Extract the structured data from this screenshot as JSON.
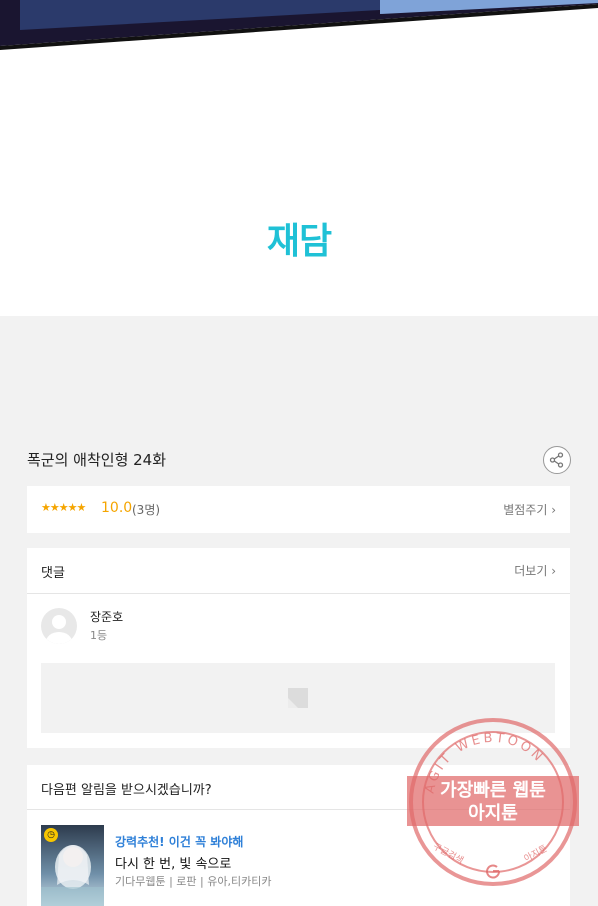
{
  "header": {
    "brand": "재담"
  },
  "episode": {
    "title": "폭군의 애착인형 24화"
  },
  "rating": {
    "stars": "★★★★★",
    "score": "10.0",
    "count": "(3명)",
    "rate_label": "별점주기 ›"
  },
  "comments": {
    "heading": "댓글",
    "more_label": "더보기 ›",
    "items": [
      {
        "author": "장준호",
        "rank": "1등"
      }
    ]
  },
  "notify": {
    "question": "다음편 알림을 받으시겠습니까?",
    "recommend_tag": "강력추천! 이건 꼭 봐야해",
    "recommend_title": "다시 한 번, 빛 속으로",
    "recommend_meta": "기다무웹툰 | 로판 | 유아,티카티카"
  },
  "watermark": {
    "ring_text": "AGIT WEBTOON",
    "main_line1": "가장빠른 웹툰",
    "main_line2": "아지툰",
    "bottom_left": "구글검색",
    "bottom_right": "아지툰"
  },
  "colors": {
    "brand": "#1fc1d6",
    "star": "#f5a500",
    "link_blue": "#2f80d8",
    "stamp_red": "#e06a6a"
  }
}
